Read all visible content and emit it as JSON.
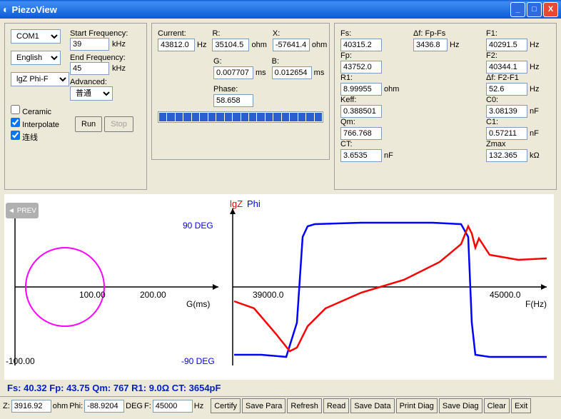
{
  "title": "PiezoView",
  "panel1": {
    "port": "COM1",
    "lang": "English",
    "plot_mode": "lgZ Phi-F",
    "start_freq_label": "Start Frequency:",
    "start_freq": "39",
    "freq_unit": "kHz",
    "end_freq_label": "End Frequency:",
    "end_freq": "45",
    "advanced_label": "Advanced:",
    "advanced": "普通",
    "ceramic": "Ceramic",
    "interpolate": "Interpolate",
    "lines": "连线",
    "run": "Run",
    "stop": "Stop"
  },
  "panel2": {
    "current_label": "Current:",
    "current": "43812.0",
    "hz": "Hz",
    "r_label": "R:",
    "r": "35104.5",
    "ohm": "ohm",
    "x_label": "X:",
    "x": "-57641.4",
    "g_label": "G:",
    "g": "0.007707",
    "ms": "ms",
    "b_label": "B:",
    "b": "0.012654",
    "phase_label": "Phase:",
    "phase": "58.658"
  },
  "panel3": {
    "fs_label": "Fs:",
    "fs": "40315.2",
    "df1_label": "Δf: Fp-Fs",
    "df1": "3436.8",
    "hz": "Hz",
    "f1_label": "F1:",
    "f1": "40291.5",
    "fp_label": "Fp:",
    "fp": "43752.0",
    "f2_label": "F2:",
    "f2": "40344.1",
    "r1_label": "R1:",
    "r1": "8.99955",
    "ohm": "ohm",
    "df2_label": "Δf: F2-F1",
    "df2": "52.6",
    "keff_label": "Keff:",
    "keff": "0.388501",
    "c0_label": "C0:",
    "c0": "3.08139",
    "nf": "nF",
    "qm_label": "Qm:",
    "qm": "766.768",
    "c1_label": "C1:",
    "c1": "0.57211",
    "ct_label": "CT:",
    "ct": "3.6535",
    "zmax_label": "Zmax",
    "zmax": "132.365",
    "kohm": "kΩ"
  },
  "chart": {
    "lgz_label": "lgZ",
    "phi_label": "Phi",
    "pos90": "90 DEG",
    "neg90": "-90 DEG",
    "neg100": "-100.00",
    "x100": "100.00",
    "x200": "200.00",
    "gms": "G(ms)",
    "x39000": "39000.0",
    "x45000": "45000.0",
    "fhz": "F(Hz)"
  },
  "summary": "Fs: 40.32  Fp: 43.75  Qm: 767  R1: 9.0Ω  CT: 3654pF",
  "status": {
    "z_label": "Z:",
    "z": "3916.92",
    "ohm": "ohm",
    "phi_label": "Phi:",
    "phi": "-88.9204",
    "deg": "DEG",
    "f_label": "F:",
    "f": "45000",
    "hz": "Hz",
    "buttons": [
      "Certify",
      "Save Para",
      "Refresh",
      "Read",
      "Save Data",
      "Print Diag",
      "Save Diag",
      "Clear",
      "Exit"
    ]
  },
  "chart_data": {
    "type": "line",
    "left_plot": {
      "type": "circle",
      "xlabel": "G(ms)",
      "x_ticks": [
        100,
        200
      ],
      "y_range": [
        -100,
        100
      ]
    },
    "right_plot": {
      "xlabel": "F(Hz)",
      "x_range": [
        38500,
        46000
      ],
      "series": [
        {
          "name": "lgZ",
          "color": "#ff0000",
          "x": [
            38500,
            39200,
            39800,
            40100,
            40300,
            40500,
            41000,
            42000,
            43000,
            43600,
            43750,
            43900,
            44200,
            45000,
            46000
          ],
          "y": [
            -20,
            -35,
            -70,
            -85,
            -82,
            -60,
            -35,
            -10,
            15,
            50,
            78,
            70,
            55,
            45,
            42
          ]
        },
        {
          "name": "Phi",
          "color": "#0000ff",
          "x": [
            38500,
            39200,
            39800,
            40100,
            40300,
            40400,
            40500,
            41000,
            43600,
            43700,
            43800,
            43900,
            44200,
            45000,
            46000
          ],
          "y": [
            -85,
            -85,
            -88,
            -50,
            60,
            85,
            88,
            89,
            89,
            80,
            -30,
            -85,
            -88,
            -88,
            -88
          ]
        }
      ],
      "y_deg_labels": [
        -90,
        90
      ]
    }
  }
}
